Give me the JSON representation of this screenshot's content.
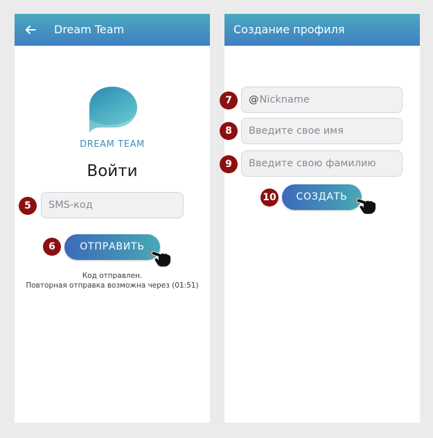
{
  "colors": {
    "page_background": "#ebebeb",
    "header_top": "#4aa8bd",
    "header_bottom": "#3f80c3",
    "button_left": "#3d69bb",
    "button_right": "#46a9b5",
    "step_badge": "#8b1010",
    "logo_text": "#3d8fbd",
    "logo_dark": "#2a8ab1",
    "logo_light": "#68c9cf"
  },
  "login_screen": {
    "header": {
      "back_icon": "arrow-left-icon",
      "title": "Dream Team"
    },
    "logo": {
      "icon": "dream-team-logo-icon",
      "text": "DREAM TEAM"
    },
    "heading": "Войти",
    "sms_field": {
      "step": "5",
      "placeholder": "SMS-код",
      "value": ""
    },
    "send_button": {
      "step": "6",
      "label": "ОТПРАВИТЬ",
      "cursor_icon": "hand-pointer-icon"
    },
    "status": {
      "sent_message": "Код отправлен.",
      "resend_message": "Повторная отправка возможна через (01:51)"
    }
  },
  "profile_screen": {
    "header": {
      "title": "Создание профиля"
    },
    "nickname_field": {
      "step": "7",
      "prefix": "@",
      "placeholder": "Nickname",
      "value": ""
    },
    "first_name_field": {
      "step": "8",
      "placeholder": "Введите свое имя",
      "value": ""
    },
    "last_name_field": {
      "step": "9",
      "placeholder": "Введите свою фамилию",
      "value": ""
    },
    "create_button": {
      "step": "10",
      "label": "СОЗДАТЬ",
      "cursor_icon": "hand-pointer-icon"
    }
  }
}
